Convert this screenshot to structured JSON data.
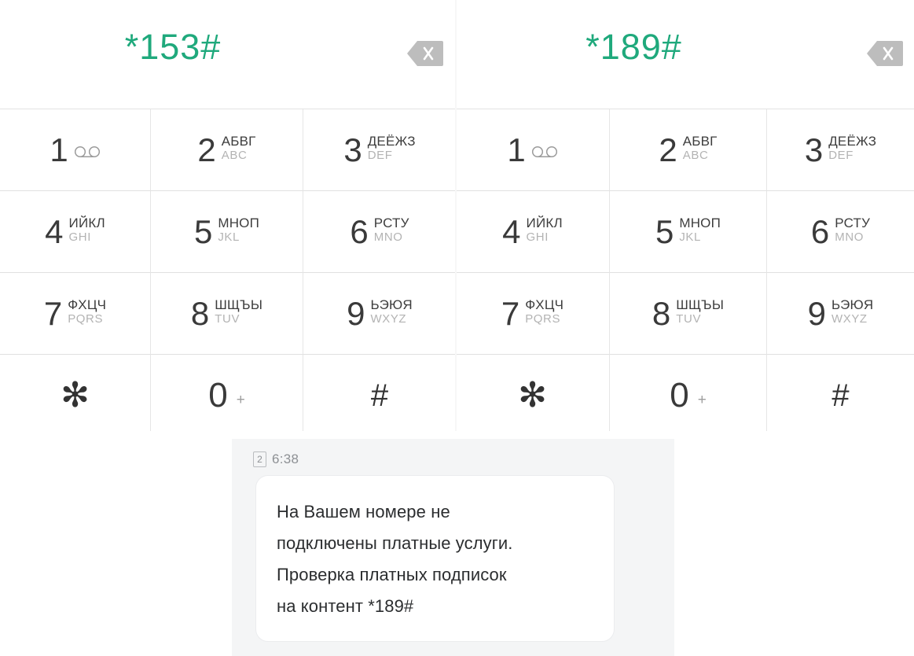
{
  "panels": [
    {
      "id": "left",
      "dialed_code": "*153#",
      "backspace_icon": "backspace-delete-icon"
    },
    {
      "id": "right",
      "dialed_code": "*189#",
      "backspace_icon": "backspace-delete-icon"
    }
  ],
  "keypad": {
    "keys": [
      {
        "digit": "1",
        "cyrillic": "",
        "latin": "",
        "icon": "voicemail-icon",
        "name": "key-1"
      },
      {
        "digit": "2",
        "cyrillic": "АБВГ",
        "latin": "ABC",
        "icon": "",
        "name": "key-2"
      },
      {
        "digit": "3",
        "cyrillic": "ДЕЁЖЗ",
        "latin": "DEF",
        "icon": "",
        "name": "key-3"
      },
      {
        "digit": "4",
        "cyrillic": "ИЙКЛ",
        "latin": "GHI",
        "icon": "",
        "name": "key-4"
      },
      {
        "digit": "5",
        "cyrillic": "МНОП",
        "latin": "JKL",
        "icon": "",
        "name": "key-5"
      },
      {
        "digit": "6",
        "cyrillic": "РСТУ",
        "latin": "MNO",
        "icon": "",
        "name": "key-6"
      },
      {
        "digit": "7",
        "cyrillic": "ФХЦЧ",
        "latin": "PQRS",
        "icon": "",
        "name": "key-7"
      },
      {
        "digit": "8",
        "cyrillic": "ШЩЪЫ",
        "latin": "TUV",
        "icon": "",
        "name": "key-8"
      },
      {
        "digit": "9",
        "cyrillic": "ЬЭЮЯ",
        "latin": "WXYZ",
        "icon": "",
        "name": "key-9"
      },
      {
        "digit": "✻",
        "cyrillic": "",
        "latin": "",
        "icon": "",
        "name": "key-star"
      },
      {
        "digit": "0",
        "cyrillic": "",
        "latin": "",
        "icon": "plus-sign",
        "name": "key-0",
        "secondary": "+"
      },
      {
        "digit": "#",
        "cyrillic": "",
        "latin": "",
        "icon": "",
        "name": "key-hash"
      }
    ]
  },
  "sms": {
    "sim_badge": "2",
    "time": "6:38",
    "body": "На Вашем номере не\nподключены платные услуги.\nПроверка платных подписок\nна контент *189#"
  },
  "colors": {
    "dial_green": "#1fa97c",
    "digit_dark": "#3a3a3a",
    "latin_gray": "#b3b3b3",
    "sms_panel_bg": "#f4f5f6",
    "bubble_bg": "#ffffff",
    "meta_gray": "#8d9094"
  }
}
